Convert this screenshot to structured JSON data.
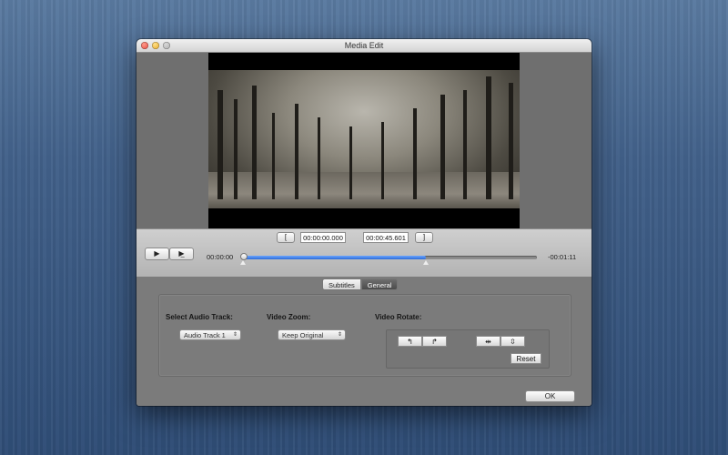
{
  "window": {
    "title": "Media Edit"
  },
  "player": {
    "play_icon": "play-icon",
    "step_icon": "step-icon",
    "mark_in": "[",
    "mark_out": "]",
    "in_time": "00:00:00.000",
    "out_time": "00:00:45.601",
    "current_time": "00:00:00",
    "remaining_time": "-00:01:11",
    "trim_fraction": 0.62
  },
  "tabs": [
    {
      "label": "Subtitles",
      "selected": false
    },
    {
      "label": "General",
      "selected": true
    }
  ],
  "general": {
    "audio_label": "Select Audio Track:",
    "audio_value": "Audio Track 1",
    "zoom_label": "Video Zoom:",
    "zoom_value": "Keep Original",
    "rotate_label": "Video Rotate:",
    "reset_label": "Reset",
    "rotate_buttons": [
      "rotate-left-icon",
      "rotate-right-icon",
      "flip-horizontal-icon",
      "flip-vertical-icon"
    ]
  },
  "footer": {
    "ok_label": "OK"
  }
}
